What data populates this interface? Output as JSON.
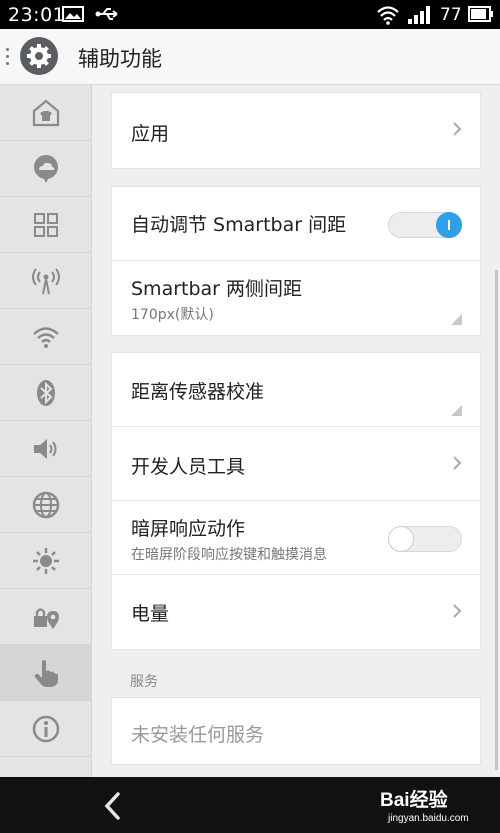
{
  "status_bar": {
    "time": "23:01",
    "battery": "77",
    "icons": [
      "image-icon",
      "usb-icon",
      "wifi-icon",
      "signal-icon",
      "battery-icon"
    ]
  },
  "action_bar": {
    "title": "辅助功能",
    "icon": "gear-icon"
  },
  "sidebar": {
    "items": [
      {
        "icon": "home-icon"
      },
      {
        "icon": "chat-cloud-icon"
      },
      {
        "icon": "grid-icon"
      },
      {
        "icon": "broadcast-icon"
      },
      {
        "icon": "wifi-icon"
      },
      {
        "icon": "bluetooth-icon"
      },
      {
        "icon": "speaker-icon"
      },
      {
        "icon": "globe-icon"
      },
      {
        "icon": "brightness-icon"
      },
      {
        "icon": "lock-location-icon"
      },
      {
        "icon": "hand-pointer-icon",
        "active": true
      },
      {
        "icon": "info-icon"
      }
    ]
  },
  "content": {
    "apps_label": "应用",
    "smartbar_auto_label": "自动调节 Smartbar 间距",
    "smartbar_auto_on": true,
    "smartbar_spacing_label": "Smartbar 两侧间距",
    "smartbar_spacing_value": "170px(默认)",
    "proximity_label": "距离传感器校准",
    "developer_label": "开发人员工具",
    "dark_screen_label": "暗屏响应动作",
    "dark_screen_sub": "在暗屏阶段响应按键和触摸消息",
    "dark_screen_on": false,
    "power_label": "电量",
    "services_header": "服务",
    "no_services_label": "未安装任何服务"
  },
  "watermark": {
    "brand": "Bai经验",
    "url": "jingyan.baidu.com"
  },
  "colors": {
    "accent": "#2f9fe6",
    "background": "#efefef",
    "sidebar": "#e4e4e4"
  }
}
